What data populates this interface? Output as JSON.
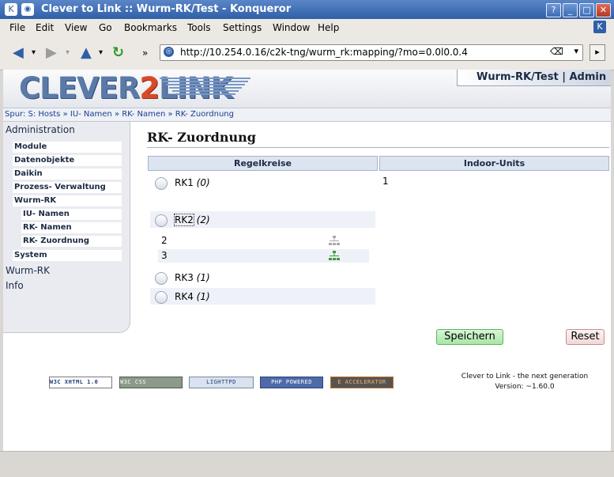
{
  "window": {
    "title": "Clever to Link :: Wurm-RK/Test - Konqueror",
    "buttons": {
      "help": "?",
      "minimize": "_",
      "maximize": "□",
      "close": "✕"
    }
  },
  "menu": [
    "File",
    "Edit",
    "View",
    "Go",
    "Bookmarks",
    "Tools",
    "Settings",
    "Window",
    "Help"
  ],
  "toolbar": {
    "url": "http://10.254.0.16/c2k-tng/wurm_rk:mapping/?mo=0.0l0.0.4",
    "icons": [
      "back-icon",
      "forward-icon",
      "up-icon",
      "reload-icon",
      "more-icon"
    ]
  },
  "header": {
    "logo_left": "CLEVER",
    "logo_two": "2",
    "logo_right": "LINK",
    "user": "Wurm-RK/Test | Admin"
  },
  "breadcrumb": "Spur: S: Hosts » IU- Namen » RK- Namen » RK- Zuordnung",
  "sidebar": {
    "items": [
      {
        "label": "Administration",
        "level": 0
      },
      {
        "label": "Module",
        "level": 1
      },
      {
        "label": "Datenobjekte",
        "level": 1
      },
      {
        "label": "Daikin",
        "level": 1
      },
      {
        "label": "Prozess- Verwaltung",
        "level": 1
      },
      {
        "label": "Wurm-RK",
        "level": 1
      },
      {
        "label": "IU- Namen",
        "level": 2
      },
      {
        "label": "RK- Namen",
        "level": 2
      },
      {
        "label": "RK- Zuordnung",
        "level": 2
      },
      {
        "label": "System",
        "level": 1
      },
      {
        "label": "Wurm-RK",
        "level": 0
      },
      {
        "label": "Info",
        "level": 0
      }
    ]
  },
  "main": {
    "title": "RK- Zuordnung",
    "col_regelkreise": "Regelkreise",
    "col_indoor": "Indoor-Units",
    "indoor_value": "1",
    "rk": [
      {
        "label": "RK1",
        "count": "(0)"
      },
      {
        "label": "RK2",
        "count": "(2)"
      },
      {
        "label": "RK3",
        "count": "(1)"
      },
      {
        "label": "RK4",
        "count": "(1)"
      }
    ],
    "rk2_units": [
      "2",
      "3"
    ],
    "save": "Speichern",
    "reset": "Reset"
  },
  "footer": {
    "badges": [
      "W3C XHTML 1.0",
      "W3C CSS",
      "LIGHTTPD",
      "PHP POWERED",
      "E ACCELERATOR"
    ],
    "line1": "Clever to Link - the next generation",
    "line2": "Version: ~1.60.0"
  },
  "colors": {
    "accent": "#2f5fa8",
    "save": "#a8e5a5",
    "reset": "#f1d7d7"
  }
}
